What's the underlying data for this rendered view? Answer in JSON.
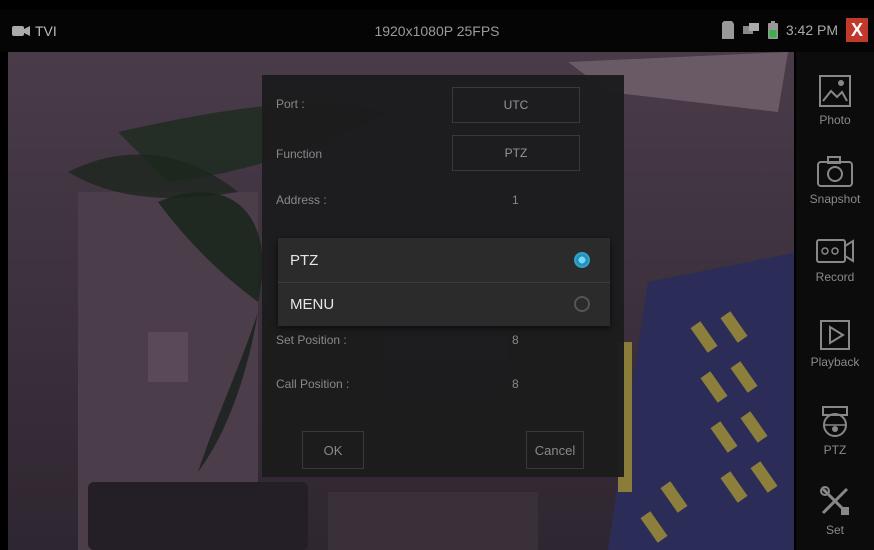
{
  "topbar": {
    "mode_label": "TVI",
    "resolution": "1920x1080P 25FPS",
    "time": "3:42 PM",
    "close_glyph": "X"
  },
  "sidebar": {
    "items": [
      {
        "label": "Photo",
        "icon": "photo-icon"
      },
      {
        "label": "Snapshot",
        "icon": "camera-icon"
      },
      {
        "label": "Record",
        "icon": "record-icon"
      },
      {
        "label": "Playback",
        "icon": "playback-icon"
      },
      {
        "label": "PTZ",
        "icon": "ptz-icon"
      },
      {
        "label": "Set",
        "icon": "tools-icon"
      }
    ]
  },
  "dialog": {
    "port_label": "Port :",
    "port_value": "UTC",
    "function_label": "Function",
    "function_value": "PTZ",
    "address_label": "Address :",
    "address_value": "1",
    "set_position_label": "Set Position :",
    "set_position_value": "8",
    "call_position_label": "Call Position :",
    "call_position_value": "8",
    "ok_label": "OK",
    "cancel_label": "Cancel"
  },
  "popup": {
    "options": [
      {
        "label": "PTZ",
        "selected": true
      },
      {
        "label": "MENU",
        "selected": false
      }
    ]
  },
  "colors": {
    "accent": "#2ea4c9",
    "close": "#c0392b",
    "overlay": "#1c1c1d"
  }
}
